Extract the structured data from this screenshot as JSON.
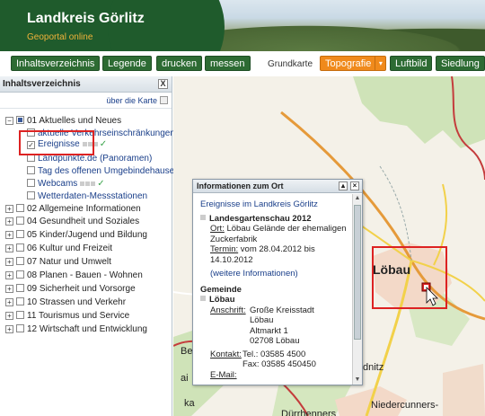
{
  "header": {
    "title": "Landkreis Görlitz",
    "subtitle": "Geoportal online"
  },
  "toolbar": {
    "buttons": [
      "Inhaltsverzeichnis",
      "Legende",
      "drucken",
      "messen"
    ],
    "basemap_label": "Grundkarte",
    "basemap_options": [
      "Topografie",
      "Luftbild",
      "Siedlung"
    ]
  },
  "sidebar": {
    "title": "Inhaltsverzeichnis",
    "close": "X",
    "map_link": "über die Karte",
    "items": [
      {
        "label": "01 Aktuelles und Neues"
      },
      {
        "label": "aktuelle Verkehrseinschränkungen"
      },
      {
        "label": "Ereignisse"
      },
      {
        "label": "Landpunkte.de (Panoramen)"
      },
      {
        "label": "Tag des offenen Umgebindehauses"
      },
      {
        "label": "Webcams"
      },
      {
        "label": "Wetterdaten-Messstationen"
      },
      {
        "label": "02 Allgemeine Informationen"
      },
      {
        "label": "04 Gesundheit und Soziales"
      },
      {
        "label": "05 Kinder/Jugend und Bildung"
      },
      {
        "label": "06 Kultur und Freizeit"
      },
      {
        "label": "07 Natur und Umwelt"
      },
      {
        "label": "08 Planen - Bauen - Wohnen"
      },
      {
        "label": "09 Sicherheit und Vorsorge"
      },
      {
        "label": "10 Strassen und Verkehr"
      },
      {
        "label": "11 Tourismus und Service"
      },
      {
        "label": "12 Wirtschaft und Entwicklung"
      }
    ]
  },
  "map": {
    "labels": {
      "lobau": "Löbau",
      "be": "Be",
      "ai": "ai",
      "ka": "ka",
      "dnitz": "dnitz",
      "niedercunners": "Niedercunners-",
      "durrhennersdorf": "Dürrhenners"
    }
  },
  "popup": {
    "title": "Informationen zum Ort",
    "section_title": "Ereignisse im Landkreis Görlitz",
    "event_name": "Landesgartenschau 2012",
    "ort_label": "Ort:",
    "ort_value": "Löbau Gelände der ehemaligen Zuckerfabrik",
    "termin_label": "Termin:",
    "termin_value": "vom 28.04.2012 bis 14.10.2012",
    "more_info": "(weitere Informationen)",
    "gemeinde_heading": "Gemeinde",
    "gemeinde_name": "Löbau",
    "anschrift_label": "Anschrift:",
    "anschrift_lines": [
      "Große Kreisstadt",
      "Löbau",
      "Altmarkt 1",
      "02708 Löbau"
    ],
    "kontakt_label": "Kontakt:",
    "tel": "Tel.: 03585 4500",
    "fax": "Fax: 03585 450450",
    "email_label": "E-Mail:"
  }
}
